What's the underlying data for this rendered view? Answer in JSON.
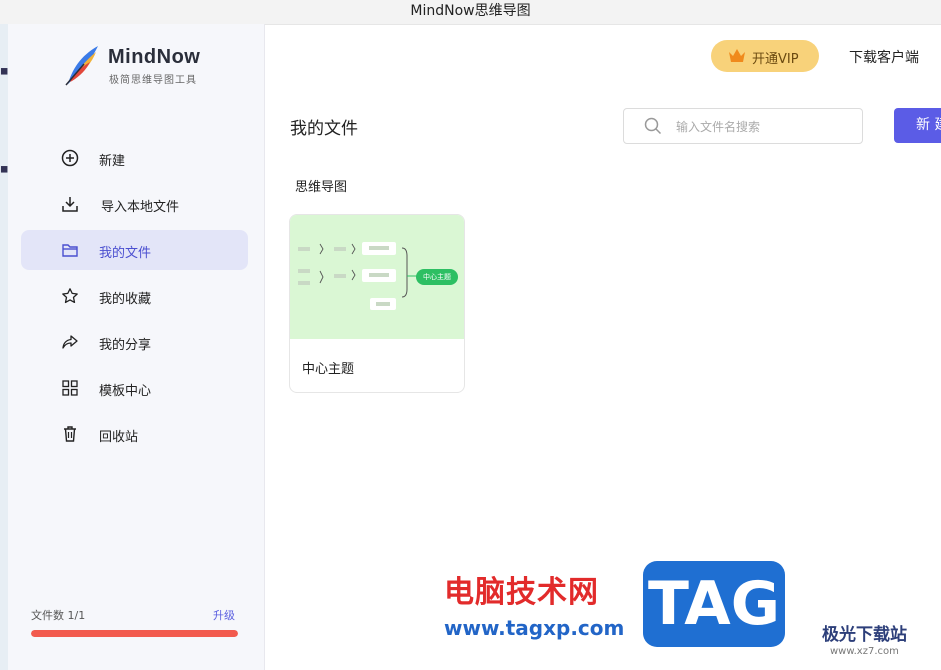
{
  "window": {
    "title": "MindNow思维导图"
  },
  "brand": {
    "name": "MindNow",
    "tagline": "极简思维导图工具"
  },
  "sidebar": {
    "items": [
      {
        "label": "新建",
        "icon": "plus-circle-icon"
      },
      {
        "label": "导入本地文件",
        "icon": "download-icon"
      },
      {
        "label": "我的文件",
        "icon": "folder-icon",
        "active": true
      },
      {
        "label": "我的收藏",
        "icon": "star-icon"
      },
      {
        "label": "我的分享",
        "icon": "share-icon"
      },
      {
        "label": "模板中心",
        "icon": "grid-icon"
      },
      {
        "label": "回收站",
        "icon": "trash-icon"
      }
    ],
    "file_count": "文件数 1/1",
    "upgrade_label": "升级",
    "usage_fraction": 1.0,
    "usage_color": "#f25a4e"
  },
  "header": {
    "vip_label": "开通VIP",
    "download_label": "下载客户端"
  },
  "main": {
    "title": "我的文件",
    "search_placeholder": "输入文件名搜索",
    "new_label": "新 建",
    "section": "思维导图",
    "cards": [
      {
        "title": "中心主题"
      }
    ],
    "thumbnail": {
      "center_topic": "中心主题"
    }
  },
  "watermark": {
    "cn": "电脑技术网",
    "url": "www.tagxp.com",
    "tag": "TAG",
    "site_cn": "极光下载站",
    "site_url": "www.xz7.com"
  },
  "colors": {
    "accent": "#5b5ce6",
    "vip": "#f8d27a",
    "thumb_bg": "#daf7d4",
    "thumb_node": "#2dbf63"
  }
}
